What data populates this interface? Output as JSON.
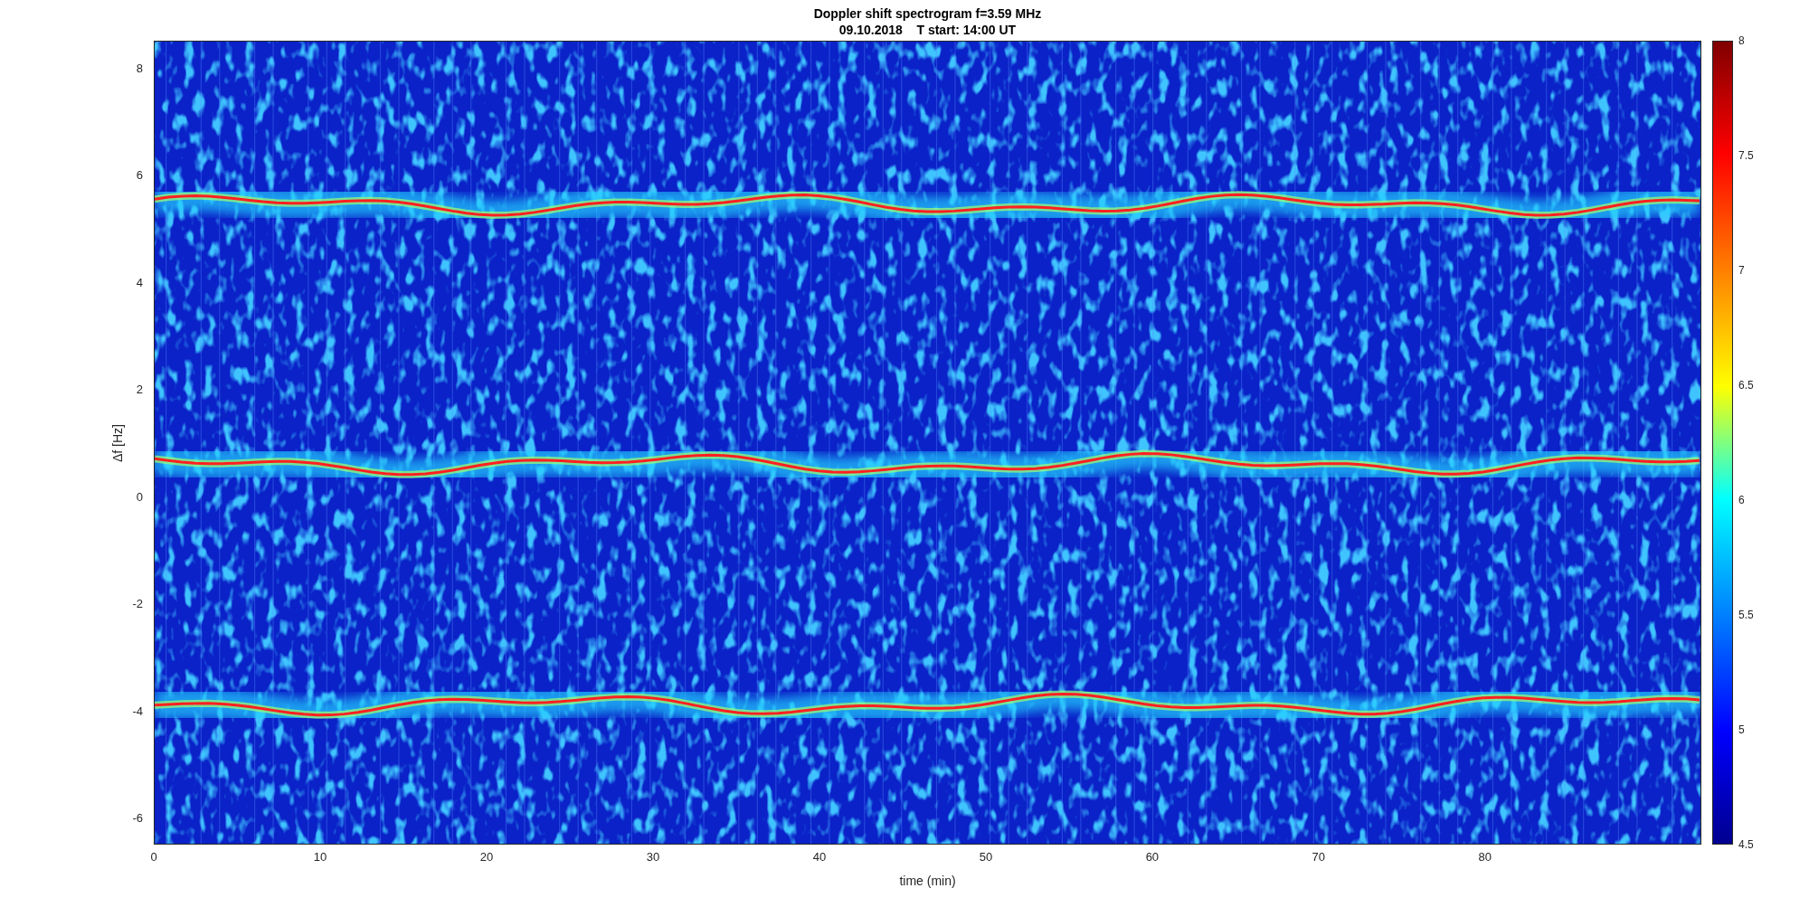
{
  "title": [
    "Doppler shift spectrogram f=3.59 MHz",
    "09.10.2018    T start: 14:00 UT"
  ],
  "y_axis": {
    "label": "Δf [Hz]",
    "ticks": [
      "8",
      "6",
      "4",
      "2",
      "0",
      "-2",
      "-4",
      "-6"
    ]
  },
  "x_axis": {
    "label": "time (min)",
    "ticks": [
      "0",
      "10",
      "20",
      "30",
      "40",
      "50",
      "60",
      "70",
      "80"
    ]
  },
  "colorbar": {
    "ticks": [
      "8",
      "7.5",
      "7",
      "6.5",
      "6",
      "5.5",
      "5",
      "4.5"
    ]
  }
}
